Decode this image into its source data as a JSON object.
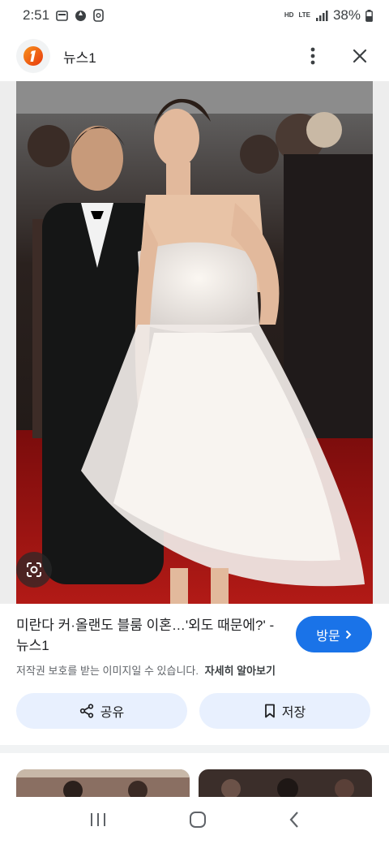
{
  "status_bar": {
    "time": "2:51",
    "network": "LTE",
    "battery": "38%",
    "hd_label": "HD"
  },
  "header": {
    "source_name": "뉴스1",
    "logo_letter": "1"
  },
  "caption": {
    "title": "미란다 커·올랜도 블룸 이혼…'외도 때문에?' - 뉴스1",
    "visit_label": "방문",
    "copyright_text": "저작권 보호를 받는 이미지일 수 있습니다.",
    "learn_more": "자세히 알아보기"
  },
  "actions": {
    "share_label": "공유",
    "save_label": "저장"
  },
  "colors": {
    "accent": "#1a73e8",
    "action_bg": "#e8f0fe",
    "logo": "#f15a24"
  }
}
